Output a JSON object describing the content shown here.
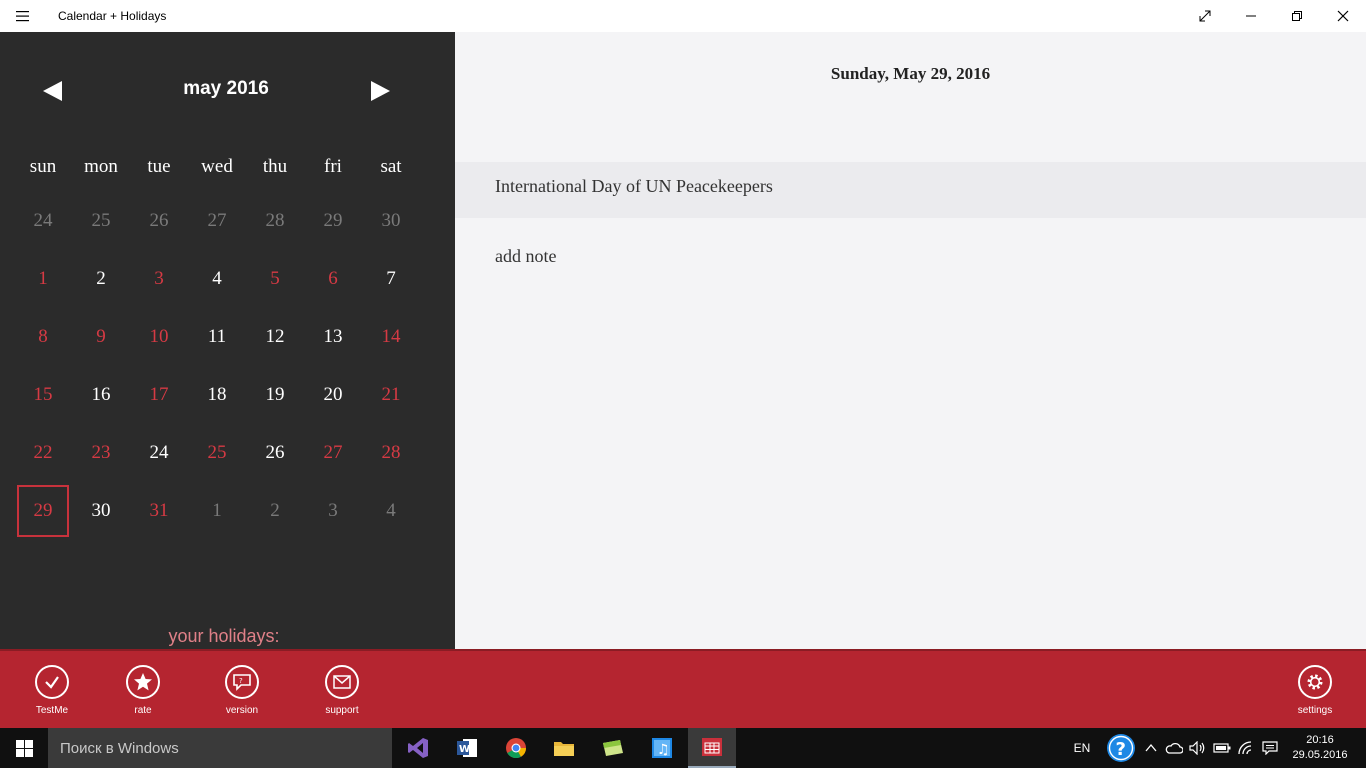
{
  "window": {
    "title": "Calendar + Holidays",
    "controls": [
      "fullscreen",
      "minimize",
      "restore",
      "close"
    ]
  },
  "calendar": {
    "month_label": "may 2016",
    "weekdays": [
      "sun",
      "mon",
      "tue",
      "wed",
      "thu",
      "fri",
      "sat"
    ],
    "weeks": [
      [
        {
          "d": "24",
          "t": "off"
        },
        {
          "d": "25",
          "t": "off"
        },
        {
          "d": "26",
          "t": "off"
        },
        {
          "d": "27",
          "t": "off"
        },
        {
          "d": "28",
          "t": "off"
        },
        {
          "d": "29",
          "t": "off"
        },
        {
          "d": "30",
          "t": "off"
        }
      ],
      [
        {
          "d": "1",
          "t": "holiday"
        },
        {
          "d": "2",
          "t": "normal"
        },
        {
          "d": "3",
          "t": "holiday"
        },
        {
          "d": "4",
          "t": "normal"
        },
        {
          "d": "5",
          "t": "holiday"
        },
        {
          "d": "6",
          "t": "holiday"
        },
        {
          "d": "7",
          "t": "normal"
        }
      ],
      [
        {
          "d": "8",
          "t": "holiday"
        },
        {
          "d": "9",
          "t": "holiday"
        },
        {
          "d": "10",
          "t": "holiday"
        },
        {
          "d": "11",
          "t": "normal"
        },
        {
          "d": "12",
          "t": "normal"
        },
        {
          "d": "13",
          "t": "normal"
        },
        {
          "d": "14",
          "t": "holiday"
        }
      ],
      [
        {
          "d": "15",
          "t": "holiday"
        },
        {
          "d": "16",
          "t": "normal"
        },
        {
          "d": "17",
          "t": "holiday"
        },
        {
          "d": "18",
          "t": "normal"
        },
        {
          "d": "19",
          "t": "normal"
        },
        {
          "d": "20",
          "t": "normal"
        },
        {
          "d": "21",
          "t": "holiday"
        }
      ],
      [
        {
          "d": "22",
          "t": "holiday"
        },
        {
          "d": "23",
          "t": "holiday"
        },
        {
          "d": "24",
          "t": "normal"
        },
        {
          "d": "25",
          "t": "holiday"
        },
        {
          "d": "26",
          "t": "normal"
        },
        {
          "d": "27",
          "t": "holiday"
        },
        {
          "d": "28",
          "t": "holiday"
        }
      ],
      [
        {
          "d": "29",
          "t": "holiday",
          "selected": true
        },
        {
          "d": "30",
          "t": "normal"
        },
        {
          "d": "31",
          "t": "holiday"
        },
        {
          "d": "1",
          "t": "off"
        },
        {
          "d": "2",
          "t": "off"
        },
        {
          "d": "3",
          "t": "off"
        },
        {
          "d": "4",
          "t": "off"
        }
      ]
    ],
    "your_holidays_label": "your holidays:"
  },
  "detail": {
    "date_title": "Sunday, May 29, 2016",
    "holiday_name": "International Day of UN Peacekeepers",
    "add_note_label": "add note"
  },
  "app_bar": {
    "buttons": [
      {
        "label": "TestMe",
        "icon": "check-icon"
      },
      {
        "label": "rate",
        "icon": "star-icon"
      },
      {
        "label": "version",
        "icon": "chat-icon"
      },
      {
        "label": "support",
        "icon": "mail-icon"
      }
    ],
    "settings_label": "settings"
  },
  "taskbar": {
    "search_placeholder": "Поиск в Windows",
    "language": "EN",
    "time": "20:16",
    "date": "29.05.2016"
  },
  "colors": {
    "accent": "#b52530",
    "holiday": "#d63a44",
    "pane_dark": "#2b2b2b"
  }
}
